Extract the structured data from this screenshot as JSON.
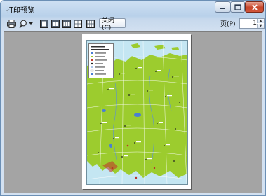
{
  "window": {
    "title": "打印预览",
    "controls": {
      "minimize_icon": "minimize-icon",
      "maximize_icon": "maximize-icon",
      "close_icon": "close-icon"
    }
  },
  "toolbar": {
    "print_icon": "printer-icon",
    "zoom_icon": "magnifier-icon",
    "zoom_dropdown_icon": "chevron-down-icon",
    "layouts": [
      "one-page-icon",
      "two-page-icon",
      "three-page-icon",
      "four-page-icon",
      "six-page-icon"
    ],
    "close_label": "关闭(C)",
    "page_label": "页(P)",
    "page_value": "1"
  },
  "preview": {
    "accent_land": "#9ccc2e",
    "accent_water": "#c4e6f2"
  }
}
